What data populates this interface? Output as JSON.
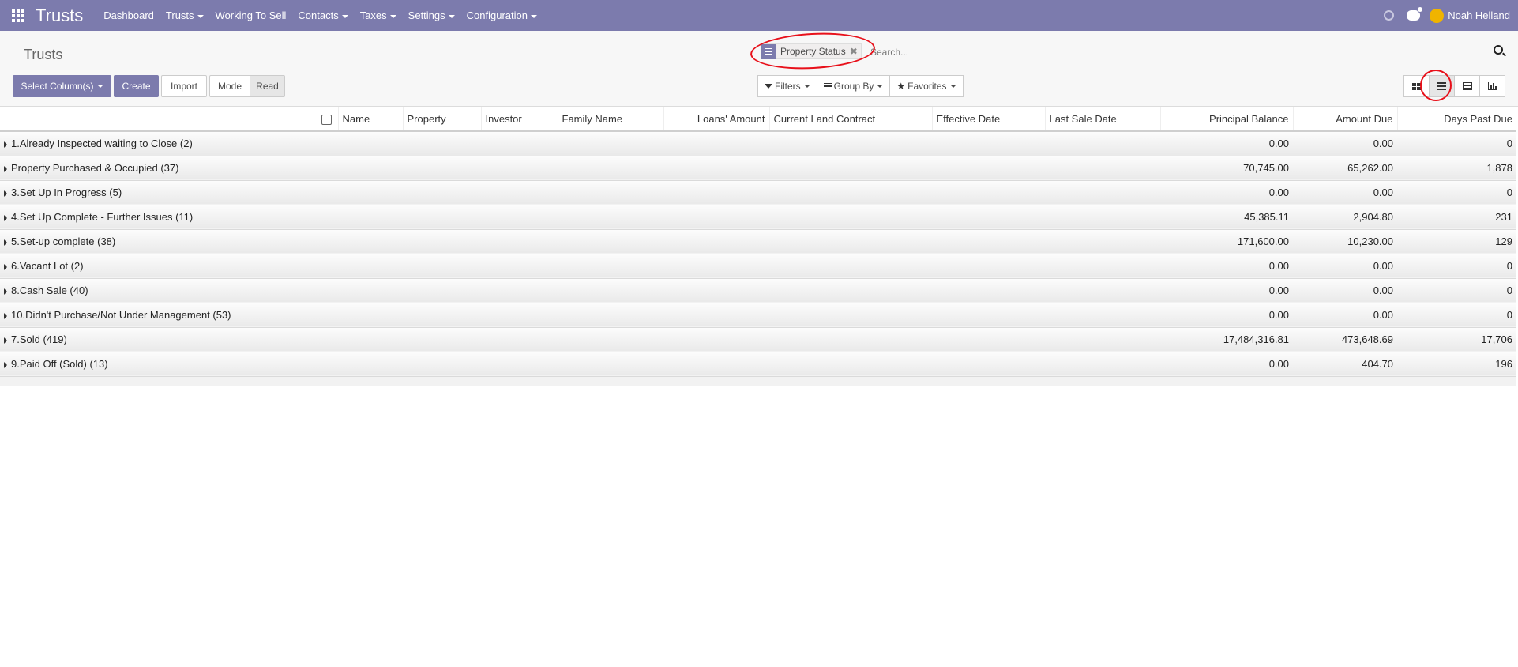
{
  "app": {
    "title": "Trusts"
  },
  "nav": {
    "items": [
      {
        "label": "Dashboard",
        "has_caret": false
      },
      {
        "label": "Trusts",
        "has_caret": true
      },
      {
        "label": "Working To Sell",
        "has_caret": false
      },
      {
        "label": "Contacts",
        "has_caret": true
      },
      {
        "label": "Taxes",
        "has_caret": true
      },
      {
        "label": "Settings",
        "has_caret": true
      },
      {
        "label": "Configuration",
        "has_caret": true
      }
    ],
    "user_name": "Noah Helland"
  },
  "breadcrumb": "Trusts",
  "buttons": {
    "select_columns": "Select Column(s)",
    "create": "Create",
    "import": "Import",
    "mode": "Mode",
    "read": "Read"
  },
  "search": {
    "facet_label": "Property Status",
    "facet_close": "✖",
    "placeholder": "Search..."
  },
  "filters": {
    "filters": "Filters",
    "group_by": "Group By",
    "favorites": "Favorites"
  },
  "table": {
    "columns": [
      "Name",
      "Property",
      "Investor",
      "Family Name",
      "Loans' Amount",
      "Current Land Contract",
      "Effective Date",
      "Last Sale Date",
      "Principal Balance",
      "Amount Due",
      "Days Past Due"
    ],
    "groups": [
      {
        "label": "1.Already Inspected waiting to Close (2)",
        "principal": "0.00",
        "due": "0.00",
        "days": "0"
      },
      {
        "label": "Property Purchased & Occupied (37)",
        "principal": "70,745.00",
        "due": "65,262.00",
        "days": "1,878"
      },
      {
        "label": "3.Set Up In Progress (5)",
        "principal": "0.00",
        "due": "0.00",
        "days": "0"
      },
      {
        "label": "4.Set Up Complete - Further Issues (11)",
        "principal": "45,385.11",
        "due": "2,904.80",
        "days": "231"
      },
      {
        "label": "5.Set-up complete (38)",
        "principal": "171,600.00",
        "due": "10,230.00",
        "days": "129"
      },
      {
        "label": "6.Vacant Lot (2)",
        "principal": "0.00",
        "due": "0.00",
        "days": "0"
      },
      {
        "label": "8.Cash Sale (40)",
        "principal": "0.00",
        "due": "0.00",
        "days": "0"
      },
      {
        "label": "10.Didn't Purchase/Not Under Management (53)",
        "principal": "0.00",
        "due": "0.00",
        "days": "0"
      },
      {
        "label": "7.Sold (419)",
        "principal": "17,484,316.81",
        "due": "473,648.69",
        "days": "17,706"
      },
      {
        "label": "9.Paid Off (Sold) (13)",
        "principal": "0.00",
        "due": "404.70",
        "days": "196"
      }
    ]
  },
  "colors": {
    "brand": "#7c7bad",
    "annotation": "#e8101a"
  }
}
